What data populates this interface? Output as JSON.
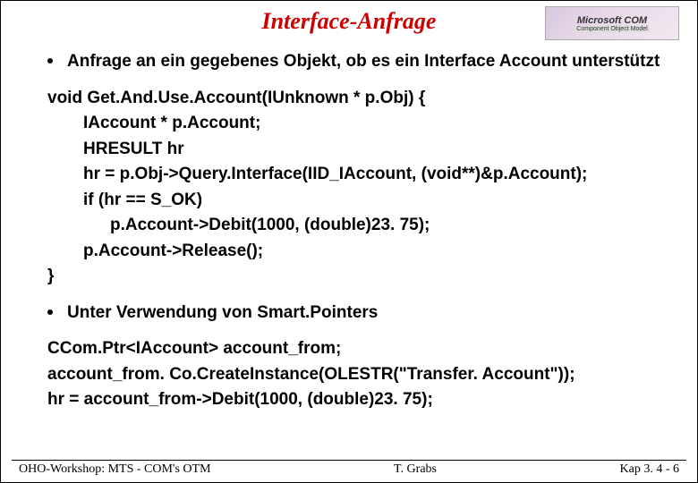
{
  "title": "Interface-Anfrage",
  "logo": {
    "top": "Microsoft COM",
    "bottom": "Component Object Model"
  },
  "bullet1": "Anfrage an ein gegebenes Objekt, ob es ein Interface Account unterstützt",
  "code1": {
    "l0": "void Get.And.Use.Account(IUnknown * p.Obj) {",
    "l1": "IAccount * p.Account;",
    "l2": "HRESULT hr",
    "l3": "hr = p.Obj->Query.Interface(IID_IAccount, (void**)&p.Account);",
    "l4": "if (hr == S_OK)",
    "l5": "p.Account->Debit(1000, (double)23. 75);",
    "l6": "p.Account->Release();",
    "l7": "}"
  },
  "bullet2": "Unter Verwendung von Smart.Pointers",
  "code2": {
    "l0": "CCom.Ptr<IAccount> account_from;",
    "l1": "account_from. Co.CreateInstance(OLESTR(\"Transfer. Account\"));",
    "l2": "hr = account_from->Debit(1000, (double)23. 75);"
  },
  "footer": {
    "left": "OHO-Workshop: MTS - COM's OTM",
    "center": "T. Grabs",
    "right": "Kap 3. 4 - 6"
  }
}
